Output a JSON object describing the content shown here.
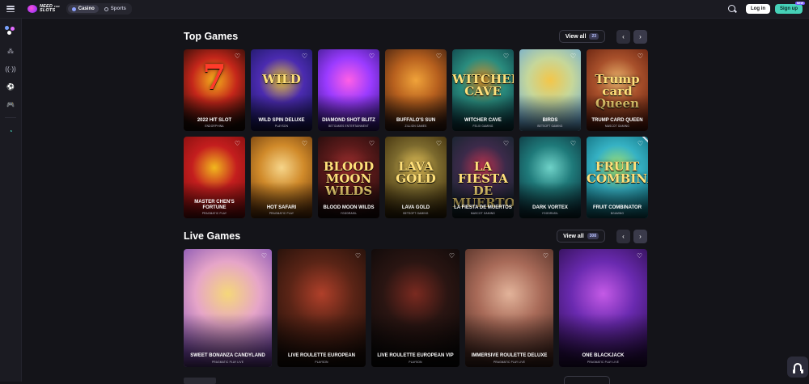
{
  "header": {
    "logo_line1": "NEED",
    "logo_line2": "SLOTS",
    "logo_small": "FOR",
    "tabs": [
      {
        "label": "Casino",
        "active": true
      },
      {
        "label": "Sports",
        "active": false
      }
    ],
    "login_label": "Log in",
    "signup_label": "Sign up",
    "signup_badge": "NEW"
  },
  "sidebar": {
    "items": [
      {
        "icon": "games-cluster-icon"
      },
      {
        "icon": "cherries-icon"
      },
      {
        "icon": "live-broadcast-icon"
      },
      {
        "icon": "football-icon"
      },
      {
        "icon": "gamepad-icon"
      },
      {
        "icon": "support-headset-icon"
      }
    ]
  },
  "sections": {
    "top_games": {
      "title": "Top Games",
      "view_all_label": "View all",
      "count": "23",
      "games": [
        {
          "name": "2022 HIT SLOT",
          "provider": "ENDORPHINA",
          "art": "7",
          "colors": [
            "#1a0a05",
            "#c4261a",
            "#f6b21c"
          ]
        },
        {
          "name": "WILD SPIN DELUXE",
          "provider": "PLAYSON",
          "art": "WILD",
          "colors": [
            "#1a1760",
            "#4b2bb0",
            "#e7c23a"
          ]
        },
        {
          "name": "DIAMOND SHOT BLITZ",
          "provider": "BETGAMES ENTERTAINMENT",
          "art": "",
          "colors": [
            "#3a1a86",
            "#9a3bff",
            "#ff5fe6"
          ]
        },
        {
          "name": "BUFFALO'S SUN",
          "provider": "ZILLION GAMES",
          "art": "",
          "colors": [
            "#3a1d10",
            "#b7601e",
            "#f0a33a"
          ]
        },
        {
          "name": "WITCHER CAVE",
          "provider": "FELIX GAMING",
          "art": "WITCHER CAVE",
          "colors": [
            "#0c3b44",
            "#2a8c7e",
            "#d38b26"
          ]
        },
        {
          "name": "BIRDS",
          "provider": "BETSOFT GAMING",
          "art": "",
          "colors": [
            "#6aa9d6",
            "#c6d79a",
            "#f3c64a"
          ]
        },
        {
          "name": "TRUMP CARD QUEEN",
          "provider": "MASCOT GAMING",
          "art": "Trump card Queen",
          "colors": [
            "#5f1d0d",
            "#a8502b",
            "#e9b26b"
          ]
        },
        {
          "name": "MASTER CHEN'S FORTUNE",
          "provider": "PRAGMATIC PLAY",
          "art": "",
          "colors": [
            "#7d0d0d",
            "#c41e1e",
            "#f2b81e"
          ]
        },
        {
          "name": "HOT SAFARI",
          "provider": "PRAGMATIC PLAY",
          "art": "",
          "colors": [
            "#6b3a0d",
            "#d08a2a",
            "#f6d58a"
          ]
        },
        {
          "name": "BLOOD MOON WILDS",
          "provider": "YGGDRASIL",
          "art": "BLOOD MOON WILDS",
          "colors": [
            "#1c0a0a",
            "#5a1a1a",
            "#a33030"
          ]
        },
        {
          "name": "LAVA GOLD",
          "provider": "BETSOFT GAMING",
          "art": "LAVA GOLD",
          "colors": [
            "#3a2a0a",
            "#7c6a2e",
            "#e9c65a"
          ]
        },
        {
          "name": "LA FIESTA DE MUERTOS",
          "provider": "MASCOT GAMING",
          "art": "LA FIESTA DE MUERTOS",
          "colors": [
            "#11242a",
            "#3c2a4a",
            "#c0344f"
          ]
        },
        {
          "name": "DARK VORTEX",
          "provider": "YGGDRASIL",
          "art": "",
          "colors": [
            "#0b2f3a",
            "#1f7a7a",
            "#6fd2c8"
          ]
        },
        {
          "name": "FRUIT COMBINATOR",
          "provider": "BGAMING",
          "art": "FRUIT COMBINATOR",
          "colors": [
            "#0f6a7a",
            "#36b2c4",
            "#a8e36a"
          ]
        }
      ]
    },
    "live_games": {
      "title": "Live Games",
      "view_all_label": "View all",
      "count": "308",
      "games": [
        {
          "name": "SWEET BONANZA CANDYLAND",
          "provider": "PRAGMATIC PLAY LIVE",
          "colors": [
            "#7a4ab0",
            "#e6a5c8",
            "#f5d77a"
          ]
        },
        {
          "name": "LIVE ROULETTE EUROPEAN",
          "provider": "PLAYSON",
          "colors": [
            "#1a0d08",
            "#5a2416",
            "#b0402a"
          ]
        },
        {
          "name": "LIVE ROULETTE EUROPEAN VIP",
          "provider": "PLAYSON",
          "colors": [
            "#0a0808",
            "#2a1512",
            "#7a2a20"
          ]
        },
        {
          "name": "IMMERSIVE ROULETTE DELUXE",
          "provider": "PRAGMATIC PLAY LIVE",
          "colors": [
            "#4a2a22",
            "#a86a58",
            "#e2b39a"
          ]
        },
        {
          "name": "ONE BLACKJACK",
          "provider": "PRAGMATIC PLAY LIVE",
          "colors": [
            "#2a0d4a",
            "#6a2ab0",
            "#c45ae6"
          ]
        }
      ]
    }
  }
}
